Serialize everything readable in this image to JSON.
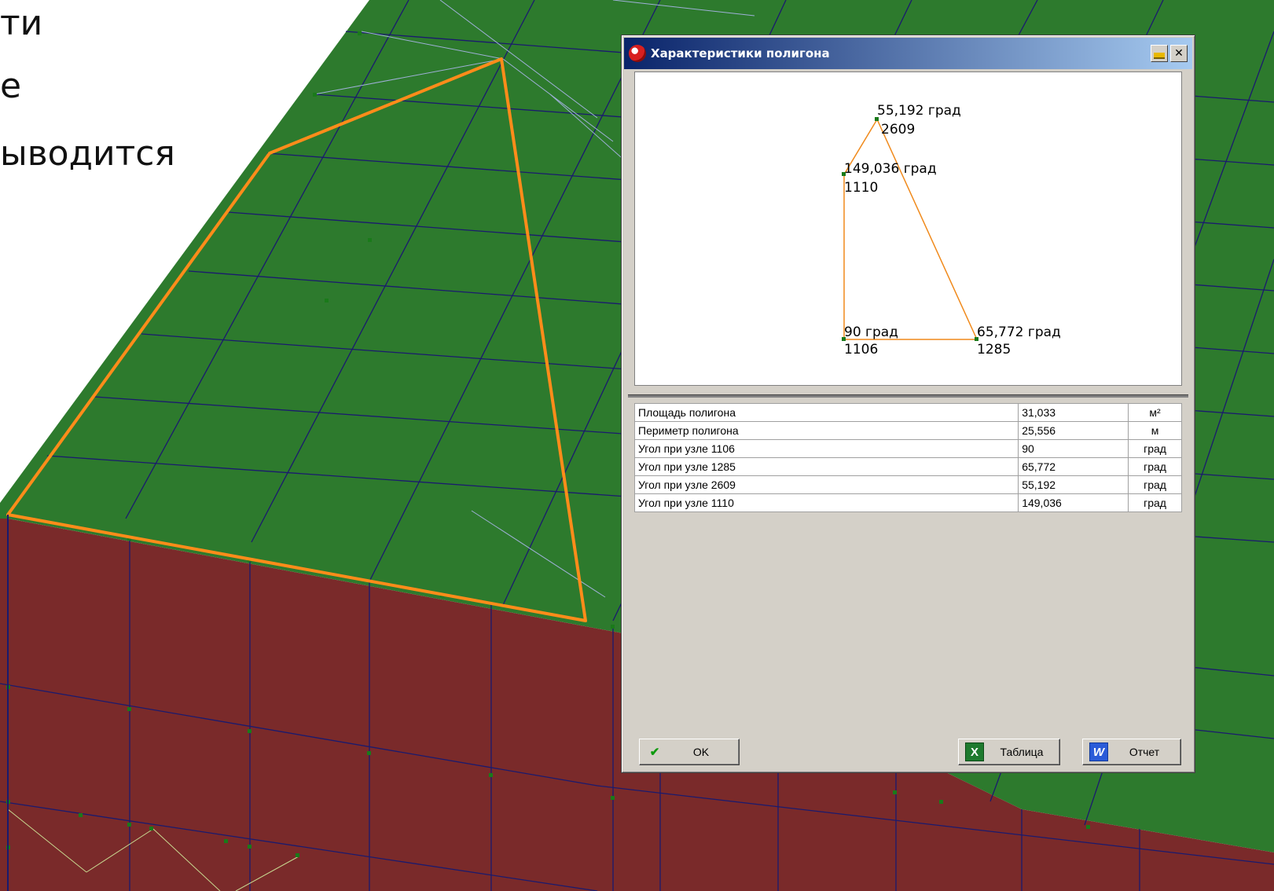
{
  "slide": {
    "lines": [
      "ти",
      "е",
      "ыводится"
    ]
  },
  "dialog": {
    "title": "Характеристики полигона",
    "preview": {
      "vertices": [
        {
          "angle": "55,192 град",
          "node": "2609"
        },
        {
          "angle": "149,036 град",
          "node": "1110"
        },
        {
          "angle": "90 град",
          "node": "1106"
        },
        {
          "angle": "65,772 град",
          "node": "1285"
        }
      ],
      "outline_color": "#f08a1c",
      "vertex_color": "#1a7a1a"
    },
    "table": [
      {
        "name": "Площадь полигона",
        "value": "31,033",
        "unit": "м²"
      },
      {
        "name": "Периметр полигона",
        "value": "25,556",
        "unit": "м"
      },
      {
        "name": "Угол при узле 1106",
        "value": "90",
        "unit": "град"
      },
      {
        "name": "Угол при узле 1285",
        "value": "65,772",
        "unit": "град"
      },
      {
        "name": "Угол при узле 2609",
        "value": "55,192",
        "unit": "град"
      },
      {
        "name": "Угол при узле 1110",
        "value": "149,036",
        "unit": "град"
      }
    ],
    "buttons": {
      "ok": "OK",
      "table": "Таблица",
      "report": "Отчет"
    }
  },
  "colors": {
    "roof": "#2d7a2d",
    "wall": "#7a2a2a",
    "mesh_line": "#1a1a6e",
    "highlight": "#ff8c1a",
    "titlebar": "#0a246a"
  }
}
